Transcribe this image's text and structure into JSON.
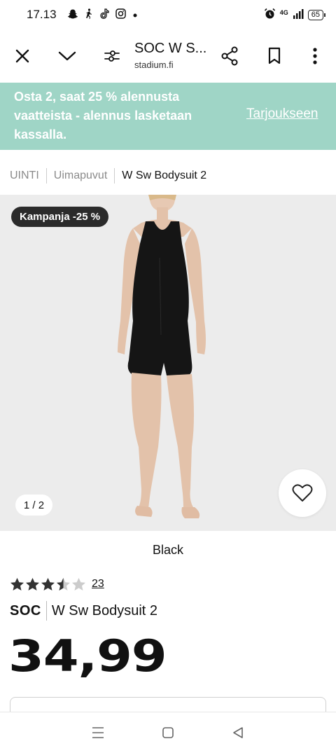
{
  "status": {
    "time": "17.13",
    "network": "4G",
    "battery": "65"
  },
  "toolbar": {
    "title": "SOC W S...",
    "url": "stadium.fi"
  },
  "promo": {
    "text": "Osta 2, saat 25 % alennusta vaatteista - alennus lasketaan kassalla.",
    "link": "Tarjoukseen"
  },
  "breadcrumb": [
    "UINTI",
    "Uimapuvut",
    "W Sw Bodysuit 2"
  ],
  "product": {
    "badge": "Kampanja -25 %",
    "image_counter": "1 / 2",
    "color": "Black",
    "rating_value": 3.5,
    "rating_count": "23",
    "brand": "SOC",
    "name": "W Sw Bodysuit 2",
    "price": "34,99"
  },
  "colors": {
    "promo_bg": "#9fd5c6",
    "badge_bg": "#2b2b2b",
    "image_bg": "#ececec"
  }
}
